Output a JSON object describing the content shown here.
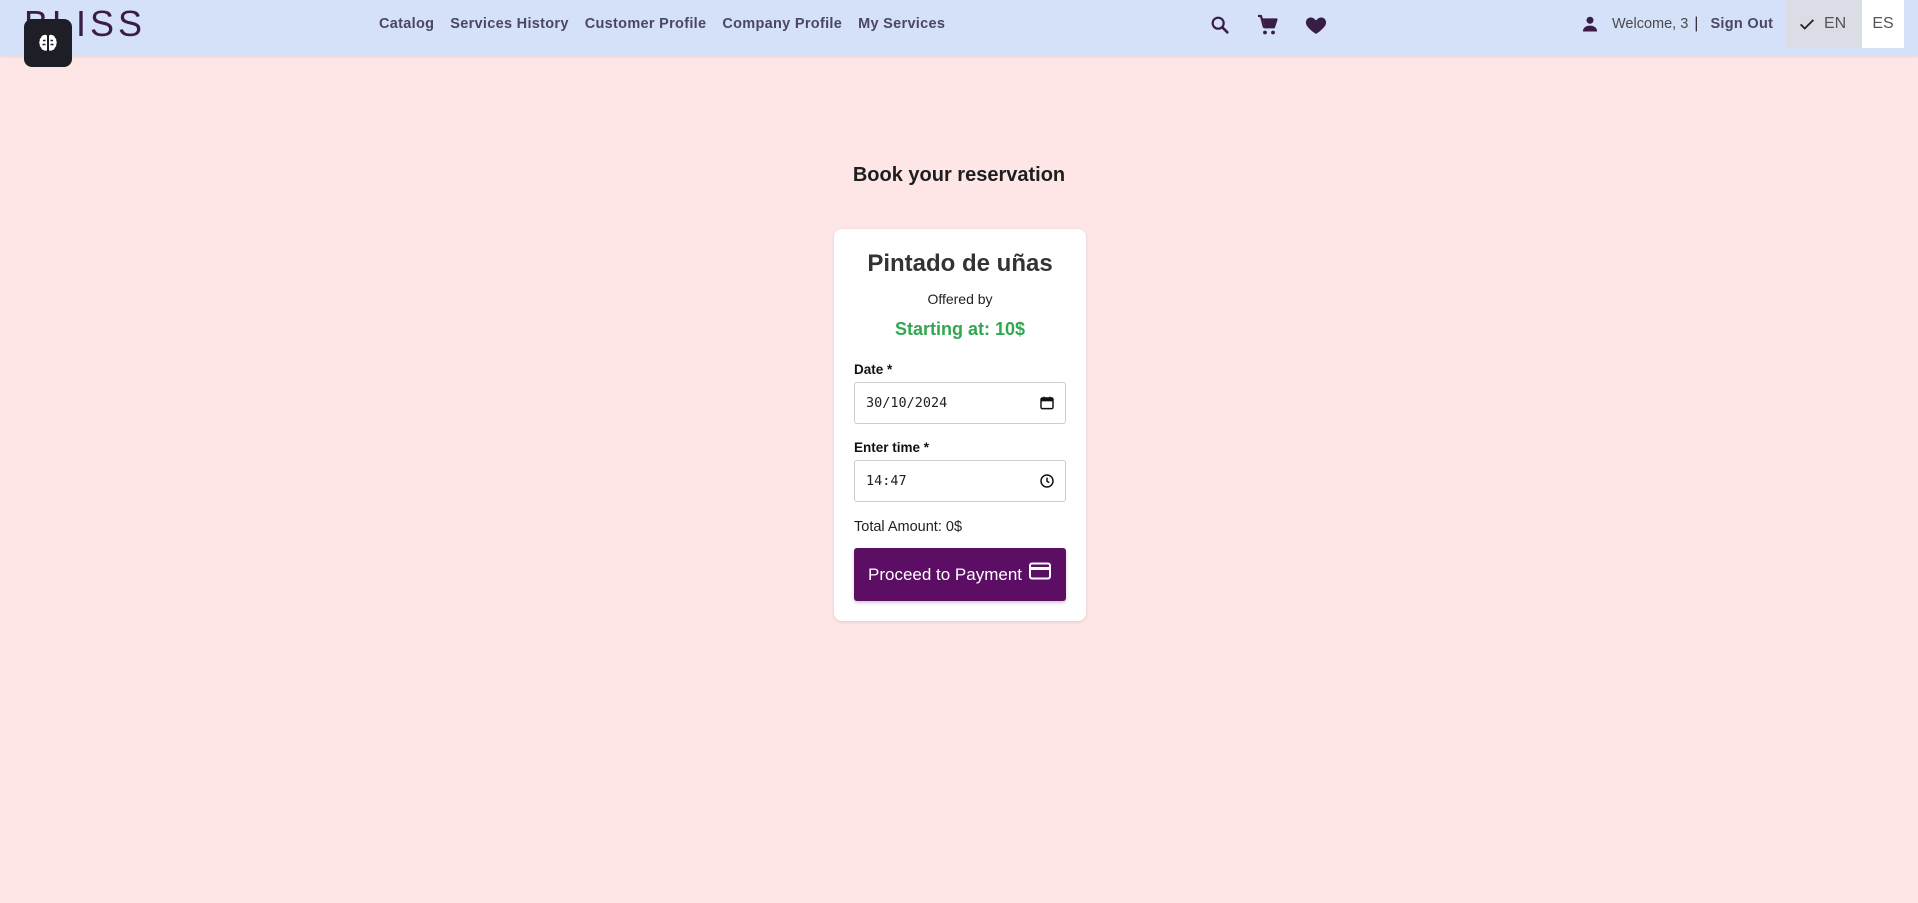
{
  "header": {
    "logo": "BLISS",
    "nav": [
      "Catalog",
      "Services History",
      "Customer Profile",
      "Company Profile",
      "My Services"
    ],
    "welcome": "Welcome, 3",
    "separator": "|",
    "sign_out": "Sign Out",
    "lang_en": "EN",
    "lang_es": "ES",
    "icon_color": "#3a1d46"
  },
  "page": {
    "title": "Book your reservation"
  },
  "card": {
    "service_name": "Pintado de uñas",
    "offered_by": "Offered by",
    "price": "Starting at: 10$",
    "date_label": "Date *",
    "date_value": "30/10/2024",
    "time_label": "Enter time *",
    "time_value": "14:47",
    "total": "Total Amount: 0$",
    "pay_button": "Proceed to Payment"
  }
}
